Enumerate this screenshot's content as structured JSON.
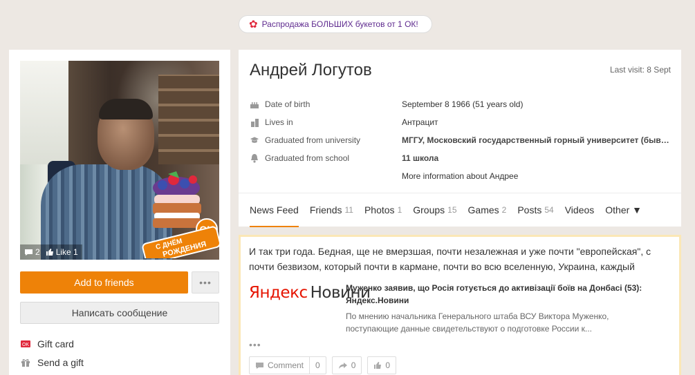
{
  "promo": {
    "text": "Распродажа БОЛЬШИХ букетов от 1 ОК!"
  },
  "photo": {
    "sticker_text_line1": "С ДНЁМ",
    "sticker_text_line2": "РОЖДЕНИЯ",
    "sticker_ok": "OK",
    "comments_count": "2",
    "like_label": "Like 1"
  },
  "left_actions": {
    "add_friends": "Add to friends",
    "more": "•••",
    "message": "Написать сообщение"
  },
  "side_links": [
    {
      "label": "Gift card",
      "icon": "gift-card-icon"
    },
    {
      "label": "Send a gift",
      "icon": "gift-icon"
    }
  ],
  "profile": {
    "name": "Андрей Логутов",
    "last_visit": "Last visit: 8 Sept",
    "info": [
      {
        "label": "Date of birth",
        "value": "September 8 1966 (51 years old)",
        "icon": "birthday-cake-icon"
      },
      {
        "label": "Lives in",
        "value": "Антрацит",
        "icon": "city-icon"
      },
      {
        "label": "Graduated from university",
        "value": "МГГУ, Московский государственный горный университет (бывш...",
        "icon": "graduation-cap-icon"
      },
      {
        "label": "Graduated from school",
        "value": "11 школа",
        "icon": "school-bell-icon"
      }
    ],
    "more_info": "More information about Андрее"
  },
  "tabs": [
    {
      "label": "News Feed",
      "count": ""
    },
    {
      "label": "Friends",
      "count": "11"
    },
    {
      "label": "Photos",
      "count": "1"
    },
    {
      "label": "Groups",
      "count": "15"
    },
    {
      "label": "Games",
      "count": "2"
    },
    {
      "label": "Posts",
      "count": "54"
    },
    {
      "label": "Videos",
      "count": ""
    },
    {
      "label": "Other ▼",
      "count": ""
    }
  ],
  "post": {
    "text": "И так три года. Бедная, ще не вмерзшая, почти незалежная и уже почти \"европейская\", с почти безвизом, который почти в кармане, почти во всю вселенную, Украина, каждый",
    "logo_ya": "Яндекс",
    "logo_news": "Новини",
    "news_title": "Муженко заявив, що Росія готується до активізації боїв на Донбасі (53): Яндекс.Новини",
    "news_snippet": "По мнению начальника Генерального штаба ВСУ Виктора Муженко, поступающие данные свидетельствуют о подготовке России к...",
    "dots": "•••",
    "comment_label": "Comment",
    "comment_count": "0",
    "share_count": "0",
    "like_count": "0"
  },
  "colors": {
    "accent": "#ee8208",
    "link": "#eb722e",
    "background": "#ede8e3"
  }
}
